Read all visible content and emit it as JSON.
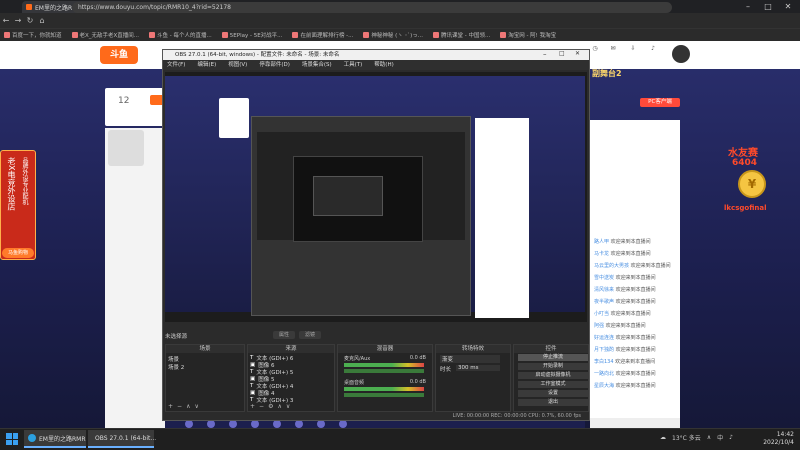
{
  "browser": {
    "tab_title": "EM里的之路RMR",
    "url": "https://www.douyu.com/topic/RMR10_4?rid=52178",
    "bookmarks": [
      "百度一下，你就知道",
      "老X_无敌手老X直播间...",
      "斗鱼 - 每个人的直播...",
      "5EPlay - 5E对战平...",
      "在前面理解排行榜 -...",
      "神秘神秘 (ヽ ･ˋ)っ...",
      "腾讯课堂 - 中国领...",
      "淘宝网 - 阿! 我淘宝"
    ]
  },
  "site": {
    "logo": "斗鱼",
    "right_title": "副舞台2",
    "room_number": "12",
    "pc_client": "PC客户端",
    "chat_lines": [
      {
        "name": "路人甲",
        "msg": "欢迎来到本直播间"
      },
      {
        "name": "马卡龙",
        "msg": "欢迎来到本直播间"
      },
      {
        "name": "马云里的大男孩",
        "msg": "欢迎来到本直播间"
      },
      {
        "name": "雪中送炭",
        "msg": "欢迎来到本直播间"
      },
      {
        "name": "清风徐来",
        "msg": "欢迎来到本直播间"
      },
      {
        "name": "夜半歌声",
        "msg": "欢迎来到本直播间"
      },
      {
        "name": "小叮当",
        "msg": "欢迎来到本直播间"
      },
      {
        "name": "阿强",
        "msg": "欢迎来到本直播间"
      },
      {
        "name": "好运连连",
        "msg": "欢迎来到本直播间"
      },
      {
        "name": "月下独酌",
        "msg": "欢迎来到本直播间"
      },
      {
        "name": "李白134",
        "msg": "欢迎来到本直播间"
      },
      {
        "name": "一路向北",
        "msg": "欢迎来到本直播间"
      },
      {
        "name": "星辰大海",
        "msg": "欢迎来到本直播间"
      }
    ],
    "side_promo_text": [
      "老",
      "X",
      "电",
      "竞",
      "外",
      "设",
      "店"
    ],
    "side_promo_text2": [
      "品",
      "牌",
      "外",
      "设",
      "专",
      "业",
      "配",
      "机"
    ],
    "side_promo_btn": "马鱼购物",
    "badge": {
      "line1": "水友赛",
      "line2": "6404",
      "coin": "¥",
      "line3": "lkcsgofinal"
    }
  },
  "obs": {
    "title": "OBS 27.0.1 (64-bit, windows) - 配置文件: 未命名 - 场景: 未命名",
    "menu": [
      "文件(F)",
      "编辑(E)",
      "视图(V)",
      "停靠部件(D)",
      "场景集合(S)",
      "工具(T)",
      "帮助(H)"
    ],
    "no_source": "未选择源",
    "props_btn": "属性",
    "filters_btn": "滤镜",
    "docks": {
      "scenes": {
        "title": "场景",
        "items": [
          "场景",
          "场景 2"
        ]
      },
      "sources": {
        "title": "来源",
        "items": [
          "文本 (GDI+) 6",
          "图像 6",
          "文本 (GDI+) 5",
          "图像 5",
          "文本 (GDI+) 4",
          "图像 4",
          "文本 (GDI+) 3",
          "图像 3"
        ]
      },
      "mixer": {
        "title": "混音器",
        "channels": [
          {
            "name": "麦克风/Aux",
            "db": "0.0 dB"
          },
          {
            "name": "桌面音频",
            "db": "0.0 dB"
          }
        ]
      },
      "transitions": {
        "title": "转场特效",
        "type": "渐变",
        "duration_label": "时长",
        "duration": "300 ms"
      },
      "controls": {
        "title": "控件",
        "buttons": [
          "停止推流",
          "开始录制",
          "启动虚拟摄像机",
          "工作室模式",
          "设置",
          "退出"
        ]
      }
    },
    "status": "LIVE: 00:00:00   REC: 00:00:00   CPU: 0.7%, 60.00 fps"
  },
  "taskbar": {
    "items": [
      "EM里的之路RMR",
      "OBS 27.0.1 (64-bit..."
    ],
    "weather": "13°C 多云",
    "ime": "中",
    "time": "14:42",
    "date": "2022/10/4"
  }
}
